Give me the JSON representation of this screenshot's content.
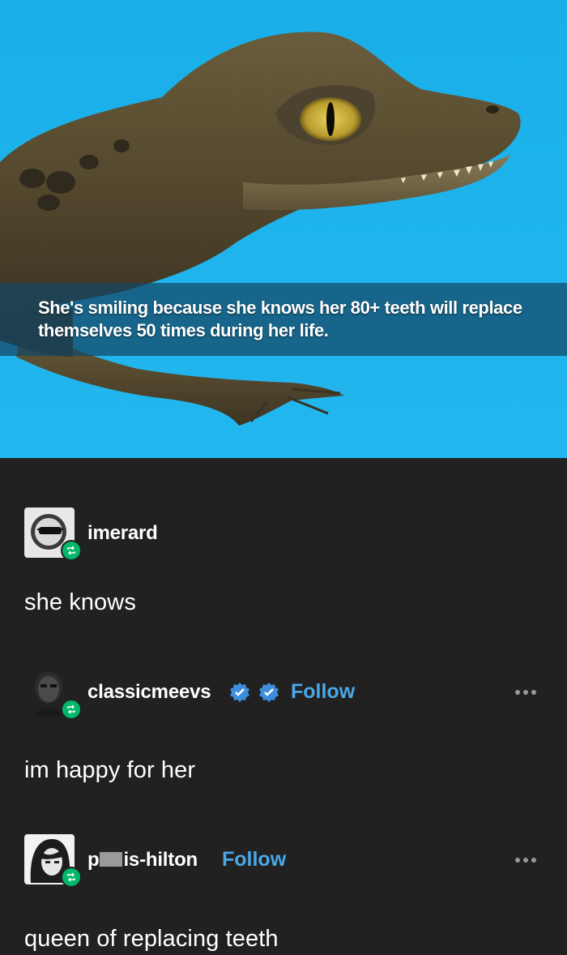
{
  "image": {
    "caption": "She's smiling because she knows her 80+ teeth will replace themselves 50 times during her life.",
    "background_color": "#1fb4ec",
    "subject": "caiman-photo"
  },
  "posts": [
    {
      "username": "imerard",
      "avatar_icon": "sunglasses-face-icon",
      "reblogged": true,
      "verified_badges": 0,
      "show_follow": false,
      "text": "she knows"
    },
    {
      "username": "classicmeevs",
      "avatar_icon": "man-portrait-icon",
      "reblogged": true,
      "verified_badges": 2,
      "show_follow": true,
      "follow_label": "Follow",
      "text": "im happy for her"
    },
    {
      "username_prefix": "p",
      "username_suffix": "is-hilton",
      "avatar_icon": "woman-portrait-icon",
      "reblogged": true,
      "verified_badges": 0,
      "show_follow": true,
      "follow_label": "Follow",
      "text": "queen of replacing teeth"
    }
  ],
  "colors": {
    "background": "#212121",
    "follow": "#4aa8e8",
    "reblog_badge": "#00b86b",
    "verified": "#3d8fdd"
  }
}
